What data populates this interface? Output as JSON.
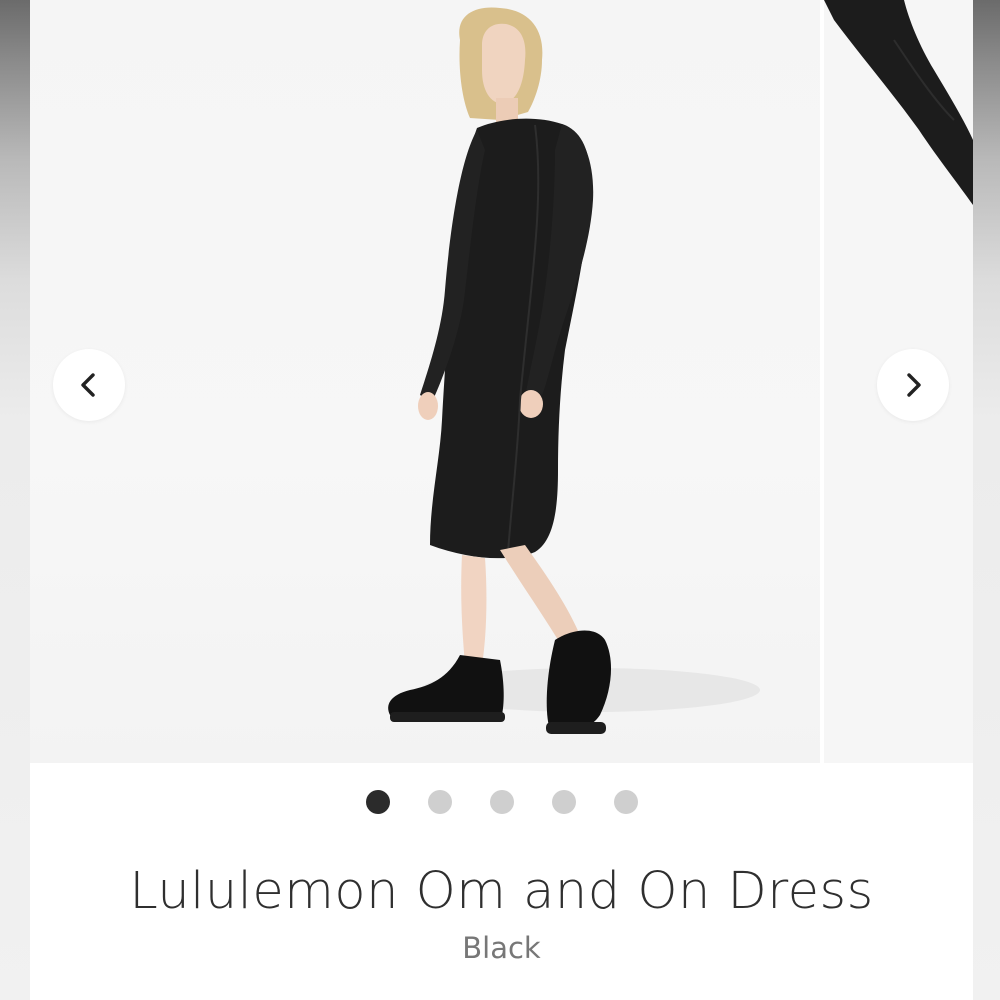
{
  "product": {
    "title": "Lululemon Om and On Dress",
    "color": "Black"
  },
  "carousel": {
    "prev_icon": "chevron-left-icon",
    "next_icon": "chevron-right-icon",
    "slide_count": 5,
    "active_index": 0
  },
  "colors": {
    "dress": "#1c1c1c",
    "active_dot": "#2b2b2b",
    "inactive_dot": "#cfcfcf",
    "title_text": "#2f2f2f",
    "subtitle_text": "#777777"
  }
}
